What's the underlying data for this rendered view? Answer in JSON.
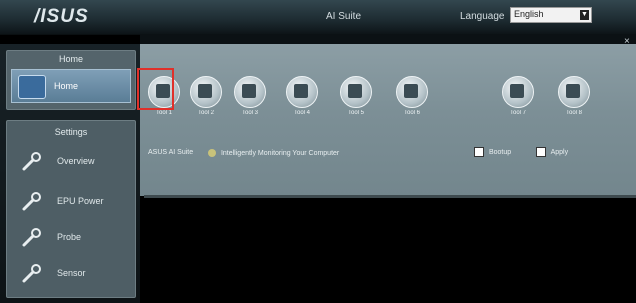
{
  "header": {
    "brand": "/ISUS",
    "center_title": "AI Suite",
    "language_label": "Language",
    "language_value": "English"
  },
  "close_label": "×",
  "sidebar": {
    "home_panel_title": "Home",
    "home_item_label": "Home",
    "settings_panel_title": "Settings",
    "settings_items": [
      {
        "label": "Overview"
      },
      {
        "label": "EPU Power"
      },
      {
        "label": "Probe"
      },
      {
        "label": "Sensor"
      }
    ]
  },
  "tools": [
    {
      "label": "Tool 1"
    },
    {
      "label": "Tool 2"
    },
    {
      "label": "Tool 3"
    },
    {
      "label": "Tool 4"
    },
    {
      "label": "Tool 5"
    },
    {
      "label": "Tool 6"
    },
    {
      "label": "Tool 7"
    },
    {
      "label": "Tool 8"
    }
  ],
  "info": {
    "left_text": "ASUS AI Suite",
    "middle_text": "Intelligently Monitoring Your Computer",
    "option_1": "Bootup",
    "option_2": "Apply"
  },
  "colors": {
    "selection_highlight": "#e0302a",
    "main_panel": "#7c8f96"
  }
}
